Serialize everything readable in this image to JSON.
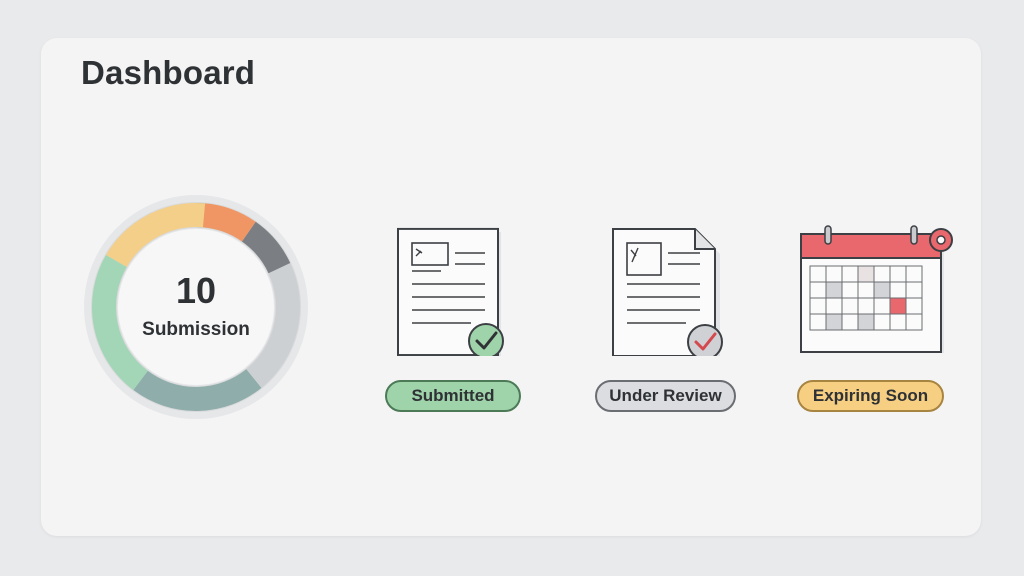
{
  "page": {
    "title": "Dashboard"
  },
  "summary": {
    "count": "10",
    "label": "Submission",
    "colors": [
      "#8f9497",
      "#f4cf89",
      "#a3d6b6",
      "#8fadaa",
      "#cdd0d3",
      "#7b7f83",
      "#ef9664"
    ]
  },
  "statuses": [
    {
      "label": "Submitted",
      "icon": "document-check-icon",
      "color": "#9fd3a9"
    },
    {
      "label": "Under Review",
      "icon": "document-review-icon",
      "color": "#dcdde0"
    },
    {
      "label": "Expiring Soon",
      "icon": "calendar-alert-icon",
      "color": "#f6cf83"
    }
  ]
}
